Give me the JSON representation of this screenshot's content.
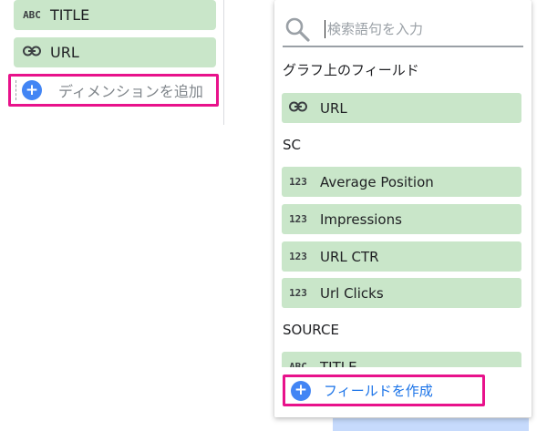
{
  "left_panel": {
    "dimensions": [
      {
        "type": "ABC",
        "label": "TITLE",
        "icon": "abc-text-icon"
      },
      {
        "type": "",
        "label": "URL",
        "icon": "link-icon"
      }
    ],
    "add_dimension_label": "ディメンションを追加"
  },
  "dropdown": {
    "search": {
      "placeholder": "検索語句を入力",
      "value": ""
    },
    "sections": [
      {
        "title": "グラフ上のフィールド",
        "fields": [
          {
            "type": "",
            "icon": "link-icon",
            "label": "URL"
          }
        ]
      },
      {
        "title": "SC",
        "fields": [
          {
            "type": "123",
            "icon": "number-icon",
            "label": "Average Position"
          },
          {
            "type": "123",
            "icon": "number-icon",
            "label": "Impressions"
          },
          {
            "type": "123",
            "icon": "number-icon",
            "label": "URL CTR"
          },
          {
            "type": "123",
            "icon": "number-icon",
            "label": "Url Clicks"
          }
        ]
      },
      {
        "title": "SOURCE",
        "fields": [
          {
            "type": "ABC",
            "icon": "abc-text-icon",
            "label": "TITLE"
          }
        ]
      }
    ],
    "create_field_label": "フィールドを作成"
  },
  "colors": {
    "chip_green": "#c9e6c9",
    "highlight_pink": "#e8128b",
    "accent_blue": "#4285f4",
    "link_blue": "#1a73e8"
  }
}
